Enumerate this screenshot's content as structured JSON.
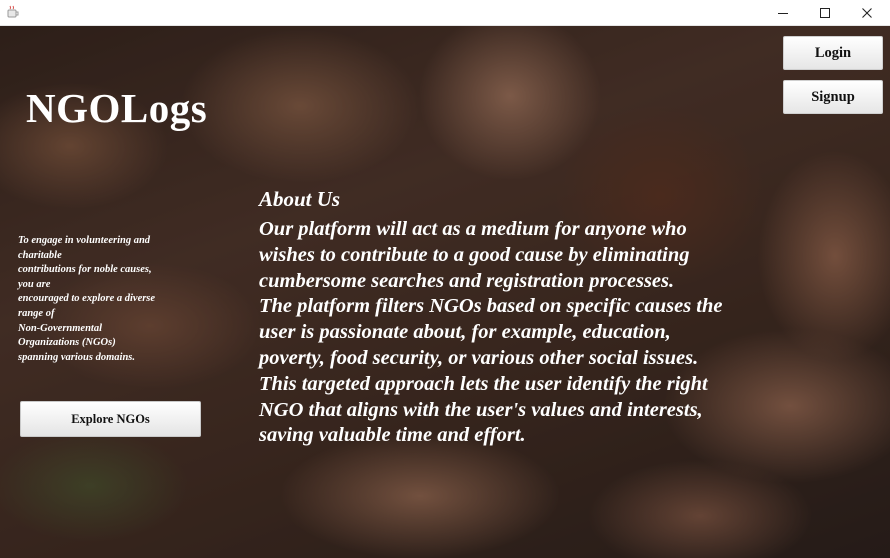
{
  "window": {
    "minimize_icon": "minimize-icon",
    "maximize_icon": "maximize-icon",
    "close_icon": "close-icon",
    "app_icon": "java-coffee-cup-icon"
  },
  "header": {
    "brand": "NGOLogs",
    "login_label": "Login",
    "signup_label": "Signup"
  },
  "intro": {
    "lines": [
      "To engage in volunteering and",
      "charitable",
      "contributions for noble causes,",
      "you are",
      "encouraged to explore a diverse",
      "range of",
      "Non-Governmental",
      "Organizations (NGOs)",
      "spanning various domains."
    ],
    "explore_label": "Explore NGOs"
  },
  "about": {
    "title": "About Us",
    "lines": [
      "Our platform will act as a medium for anyone who",
      "wishes to contribute to a good cause by eliminating",
      "cumbersome searches and registration processes.",
      "The platform filters NGOs based on specific causes the",
      "user is passionate about, for example, education,",
      "poverty, food security, or various other social issues.",
      "This targeted approach lets the user identify the right",
      "NGO that aligns with the user's values and interests,",
      "saving valuable time and effort."
    ]
  },
  "colors": {
    "text": "#ffffff",
    "button_bg": "#f2f2f2",
    "button_text": "#111111"
  }
}
